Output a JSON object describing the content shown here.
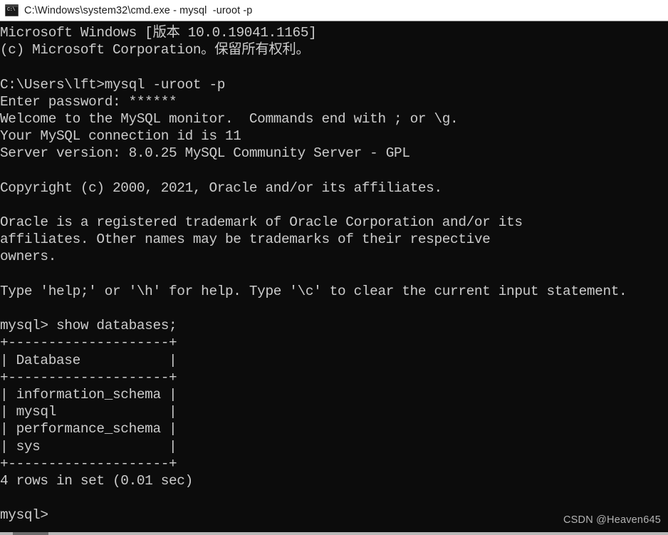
{
  "window": {
    "title": "C:\\Windows\\system32\\cmd.exe - mysql  -uroot -p",
    "icon": "cmd-console-icon",
    "icon_glyph": "C:\\",
    "titlebar_bg": "#ffffff",
    "titlebar_fg": "#1b1b1b",
    "terminal_bg": "#0c0c0c",
    "terminal_fg": "#cccccc"
  },
  "console": {
    "lines": [
      "Microsoft Windows [版本 10.0.19041.1165]",
      "(c) Microsoft Corporation。保留所有权利。",
      "",
      "C:\\Users\\lft>mysql -uroot -p",
      "Enter password: ******",
      "Welcome to the MySQL monitor.  Commands end with ; or \\g.",
      "Your MySQL connection id is 11",
      "Server version: 8.0.25 MySQL Community Server - GPL",
      "",
      "Copyright (c) 2000, 2021, Oracle and/or its affiliates.",
      "",
      "Oracle is a registered trademark of Oracle Corporation and/or its",
      "affiliates. Other names may be trademarks of their respective",
      "owners.",
      "",
      "Type 'help;' or '\\h' for help. Type '\\c' to clear the current input statement.",
      "",
      "mysql> show databases;",
      "+--------------------+",
      "| Database           |",
      "+--------------------+",
      "| information_schema |",
      "| mysql              |",
      "| performance_schema |",
      "| sys                |",
      "+--------------------+",
      "4 rows in set (0.01 sec)",
      "",
      "mysql>"
    ],
    "command_entered": "show databases;",
    "prompt": "mysql>",
    "shell_prompt": "C:\\Users\\lft>",
    "shell_command": "mysql -uroot -p",
    "password_mask": "******",
    "mysql_version": "8.0.25",
    "mysql_edition": "MySQL Community Server - GPL",
    "connection_id": "11",
    "result_summary": "4 rows in set (0.01 sec)",
    "table": {
      "header": "Database",
      "rows": [
        "information_schema",
        "mysql",
        "performance_schema",
        "sys"
      ],
      "row_count": 4,
      "elapsed": "0.01 sec"
    }
  },
  "watermark": {
    "text": "CSDN @Heaven645"
  }
}
